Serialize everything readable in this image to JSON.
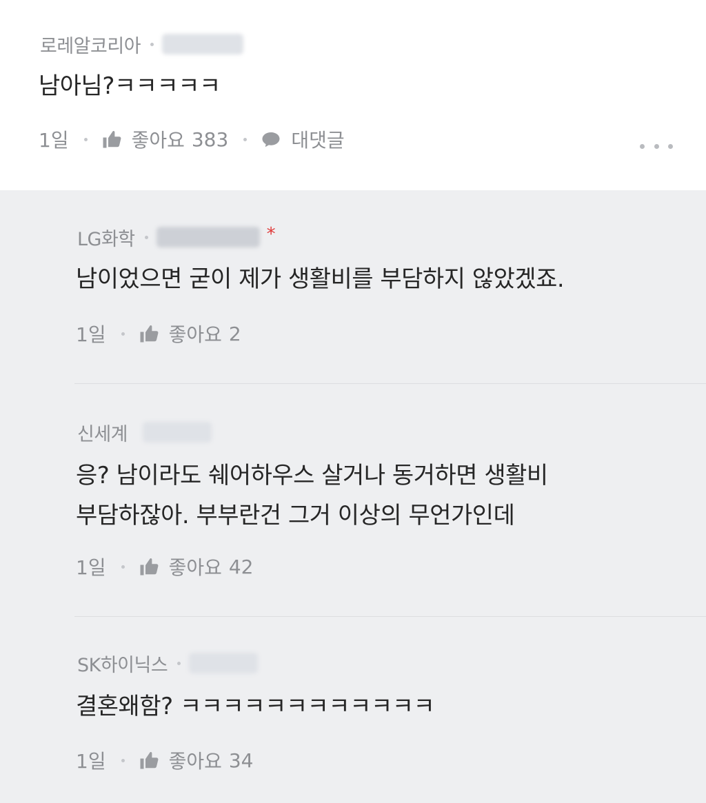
{
  "top_comment": {
    "author": "로레알코리아",
    "body": "남아님?ㅋㅋㅋㅋㅋ",
    "time": "1일",
    "like_label": "좋아요",
    "like_count": "383",
    "reply_label": "대댓글"
  },
  "replies": [
    {
      "author": "LG화학",
      "flag": "*",
      "body_lines": [
        "남이었으면 굳이 제가 생활비를 부담하지 않았겠죠."
      ],
      "time": "1일",
      "like_label": "좋아요",
      "like_count": "2"
    },
    {
      "author": "신세계",
      "body_lines": [
        "응? 남이라도 쉐어하우스 살거나 동거하면 생활비",
        "부담하잖아. 부부란건 그거 이상의 무언가인데"
      ],
      "time": "1일",
      "like_label": "좋아요",
      "like_count": "42"
    },
    {
      "author": "SK하이닉스",
      "body_lines": [
        "결혼왜함? ㅋㅋㅋㅋㅋㅋㅋㅋㅋㅋㅋㅋ"
      ],
      "time": "1일",
      "like_label": "좋아요",
      "like_count": "34"
    }
  ],
  "icons": {
    "like": "thumbs-up-icon",
    "reply": "speech-bubble-icon",
    "more": "more-dots-icon"
  },
  "colors": {
    "reply_background": "#eeeff1",
    "meta_text": "#8d8f93",
    "flag": "#e03b3b"
  }
}
